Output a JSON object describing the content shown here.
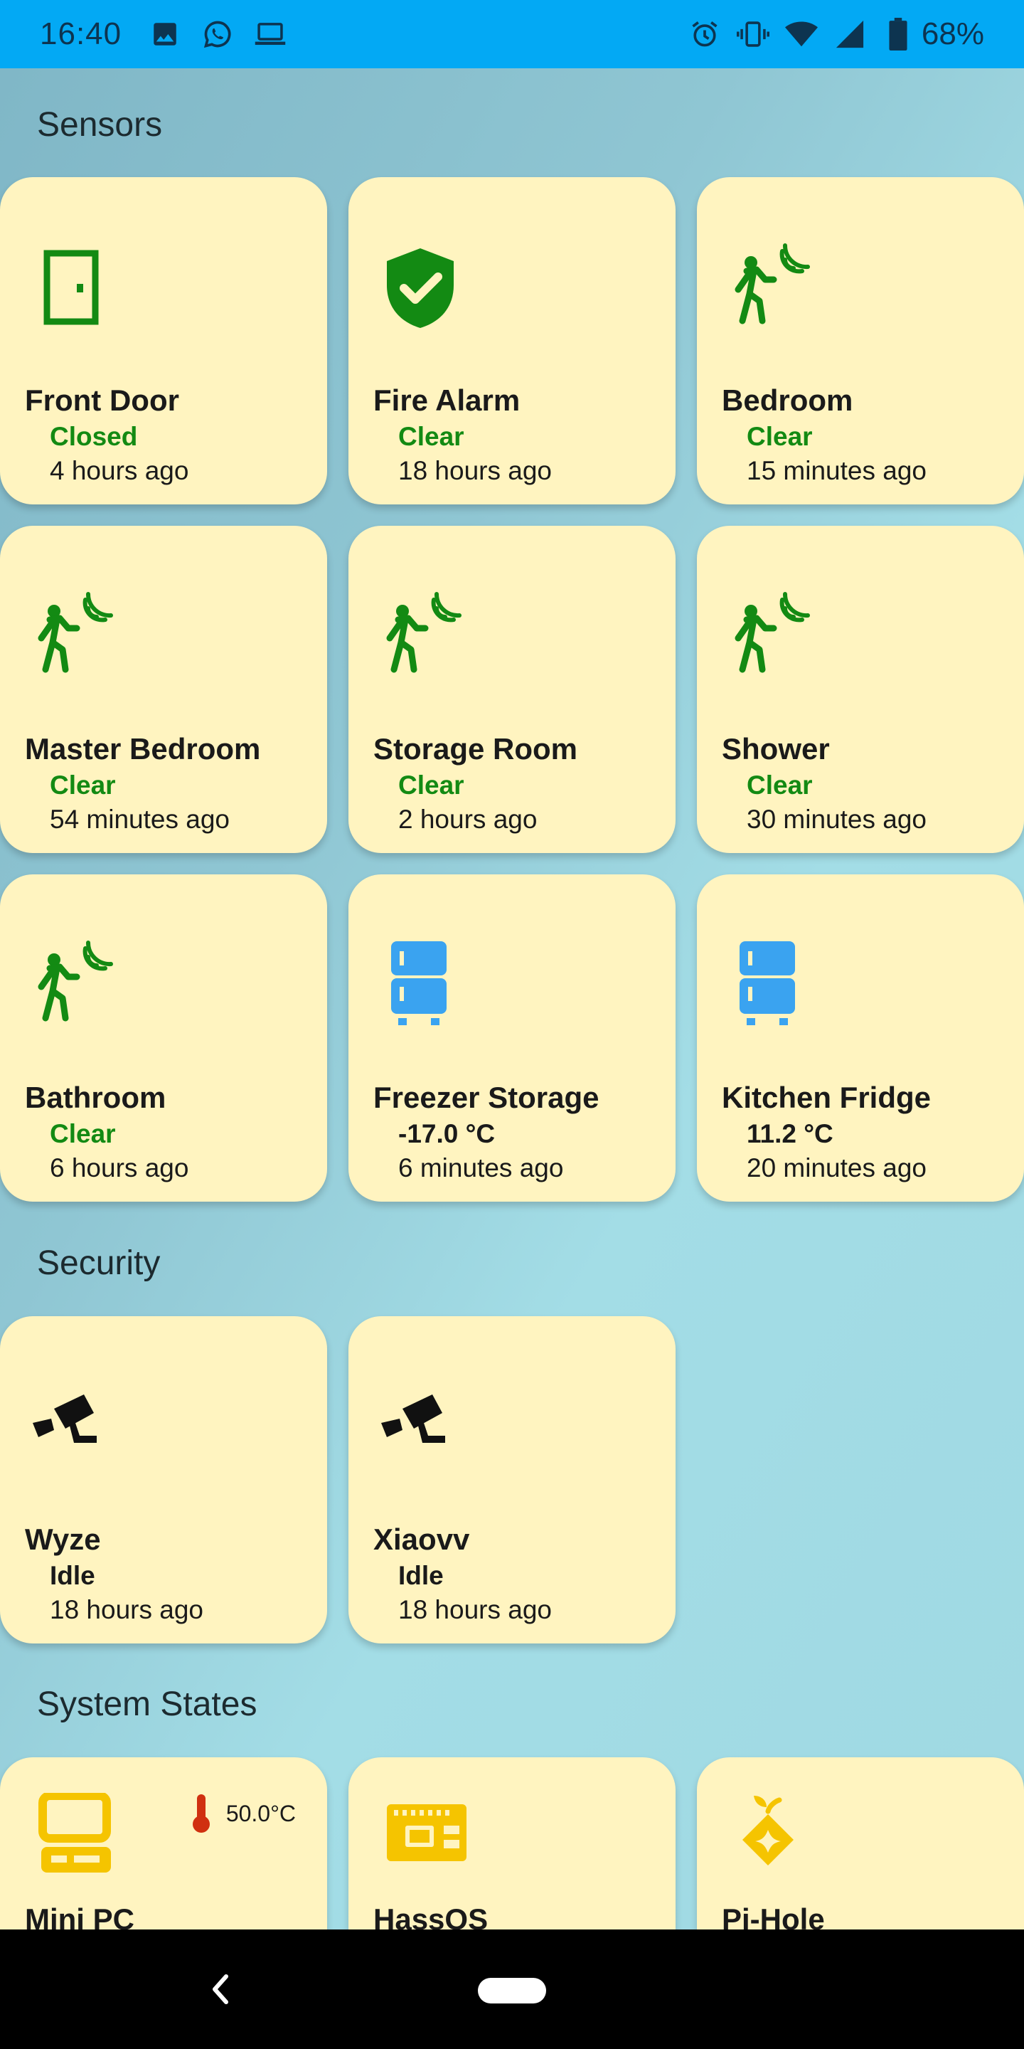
{
  "status_bar": {
    "time": "16:40",
    "battery": "68%",
    "left_icons": [
      "image-icon",
      "whatsapp-icon",
      "laptop-icon"
    ],
    "right_icons": [
      "alarm-icon",
      "vibrate-icon",
      "wifi-icon",
      "signal-icon",
      "battery-icon"
    ]
  },
  "colors": {
    "status_green": "#138a13",
    "card_bg": "#fff4c0",
    "fridge_blue": "#3aa3f0",
    "system_amber": "#f5c400",
    "thermo_red": "#d03010"
  },
  "sections": {
    "sensors": {
      "title": "Sensors",
      "cards": [
        {
          "name": "Front Door",
          "state": "Closed",
          "time": "4 hours ago",
          "icon": "door-icon"
        },
        {
          "name": "Fire Alarm",
          "state": "Clear",
          "time": "18 hours ago",
          "icon": "shield-check-icon"
        },
        {
          "name": "Bedroom",
          "state": "Clear",
          "time": "15 minutes ago",
          "icon": "motion-sensor-icon"
        },
        {
          "name": "Master Bedroom",
          "state": "Clear",
          "time": "54 minutes ago",
          "icon": "motion-sensor-icon"
        },
        {
          "name": "Storage Room",
          "state": "Clear",
          "time": "2 hours ago",
          "icon": "motion-sensor-icon"
        },
        {
          "name": "Shower",
          "state": "Clear",
          "time": "30 minutes ago",
          "icon": "motion-sensor-icon"
        },
        {
          "name": "Bathroom",
          "state": "Clear",
          "time": "6 hours ago",
          "icon": "motion-sensor-icon"
        },
        {
          "name": "Freezer Storage",
          "state": "-17.0 °C",
          "time": "6 minutes ago",
          "icon": "fridge-icon"
        },
        {
          "name": "Kitchen Fridge",
          "state": "11.2 °C",
          "time": "20 minutes ago",
          "icon": "fridge-icon"
        }
      ]
    },
    "security": {
      "title": "Security",
      "cards": [
        {
          "name": "Wyze",
          "state": "Idle",
          "time": "18 hours ago",
          "icon": "cctv-icon"
        },
        {
          "name": "Xiaovv",
          "state": "Idle",
          "time": "18 hours ago",
          "icon": "cctv-icon"
        }
      ]
    },
    "system_states": {
      "title": "System States",
      "cards": [
        {
          "name": "Mini PC",
          "temp": "50.0°C",
          "icon": "desktop-pc-icon"
        },
        {
          "name": "HassOS",
          "icon": "raspberry-board-icon"
        },
        {
          "name": "Pi-Hole",
          "icon": "pi-hole-icon"
        }
      ]
    }
  },
  "nav_bar": {
    "back_icon": "back-chevron-icon",
    "home_icon": "home-pill-icon"
  }
}
